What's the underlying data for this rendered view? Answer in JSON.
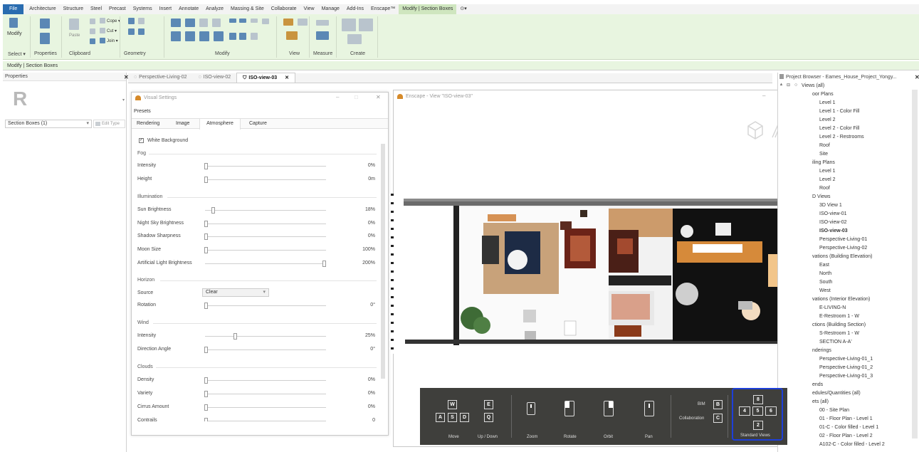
{
  "menu": {
    "items": [
      "File",
      "Architecture",
      "Structure",
      "Steel",
      "Precast",
      "Systems",
      "Insert",
      "Annotate",
      "Analyze",
      "Massing & Site",
      "Collaborate",
      "View",
      "Manage",
      "Add-Ins",
      "Enscape™",
      "Modify | Section Boxes"
    ],
    "active": "Modify | Section Boxes"
  },
  "ribbon": {
    "select_label": "Select ▾",
    "properties_label": "Properties",
    "clipboard_label": "Clipboard",
    "geometry_label": "Geometry",
    "modify_label": "Modify",
    "view_label": "View",
    "measure_label": "Measure",
    "create_label": "Create",
    "modify_button": "Modify",
    "paste_button": "Paste",
    "cope_button": "Cope ▾",
    "cut_button": "Cut ▾",
    "join_button": "Join ▾"
  },
  "context_bar": "Modify | Section Boxes",
  "properties": {
    "title": "Properties",
    "type_selector": "Section Boxes (1)",
    "edit_type": "Edit Type"
  },
  "tabs": [
    {
      "label": "Perspective-Living-02",
      "active": false
    },
    {
      "label": "ISO-view-02",
      "active": false
    },
    {
      "label": "ISO-view-03",
      "active": true
    }
  ],
  "visual_settings": {
    "title": "Visual Settings",
    "presets_label": "Presets",
    "tabs": [
      "Rendering",
      "Image",
      "Atmosphere",
      "Capture"
    ],
    "active_tab": "Atmosphere",
    "white_background": "White Background",
    "fog": {
      "label": "Fog",
      "intensity_label": "Intensity",
      "intensity_value": "0%",
      "height_label": "Height",
      "height_value": "0m"
    },
    "illumination": {
      "label": "Illumination",
      "rows": [
        {
          "label": "Sun Brightness",
          "value": "18%",
          "level": 0.06
        },
        {
          "label": "Night Sky Brightness",
          "value": "0%",
          "level": 0.0
        },
        {
          "label": "Shadow Sharpness",
          "value": "0%",
          "level": 0.0
        },
        {
          "label": "Moon Size",
          "value": "100%",
          "level": 0.0
        },
        {
          "label": "Artificial Light Brightness",
          "value": "200%",
          "level": 1.0
        }
      ]
    },
    "horizon": {
      "label": "Horizon",
      "source_label": "Source",
      "source_value": "Clear",
      "rotation_label": "Rotation",
      "rotation_value": "0°"
    },
    "wind": {
      "label": "Wind",
      "intensity_label": "Intensity",
      "intensity_value": "25%",
      "direction_label": "Direction Angle",
      "direction_value": "0°"
    },
    "clouds": {
      "label": "Clouds",
      "rows": [
        {
          "label": "Density",
          "value": "0%"
        },
        {
          "label": "Variety",
          "value": "0%"
        },
        {
          "label": "Cirrus Amount",
          "value": "0%"
        },
        {
          "label": "Contrails",
          "value": "0"
        }
      ]
    }
  },
  "enscape": {
    "title": "Enscape - View \"ISO-view-03\"",
    "controls": {
      "move_label": "Move",
      "updown_label": "Up / Down",
      "zoom_label": "Zoom",
      "rotate_label": "Rotate",
      "orbit_label": "Orbit",
      "pan_label": "Pan",
      "collab_label": "Collaboration",
      "bim_label": "BIM",
      "views_label": "Standard Views",
      "keys_move": [
        "W",
        "A",
        "S",
        "D"
      ],
      "keys_updown": [
        "E",
        "Q"
      ],
      "key_bim": "B",
      "key_collab": "C",
      "views_keys": [
        "8",
        "4",
        "5",
        "6",
        "2"
      ]
    }
  },
  "project_browser": {
    "title": "Project Browser - Eames_House_Project_Yongy...",
    "items": [
      "Views (all)",
      "oor Plans",
      "Level 1",
      "Level 1 - Color Fill",
      "Level 2",
      "Level 2 - Color Fill",
      "Level 2 - Restrooms",
      "Roof",
      "Site",
      "iling Plans",
      "Level 1",
      "Level 2",
      "Roof",
      "D Views",
      "3D View 1",
      "ISO-view-01",
      "ISO-view-02",
      "ISO-view-03",
      "Perspective-Living-01",
      "Perspective-Living-02",
      "vations (Building Elevation)",
      "East",
      "North",
      "South",
      "West",
      "vations (Interior Elevation)",
      "E-LIVING-N",
      "E-Restroom 1 - W",
      "ctions (Building Section)",
      "S-Restroom 1 - W",
      "SECTION A-A'",
      "nderings",
      "Perspective-Living-01_1",
      "Perspective-Living-01_2",
      "Perspective-Living-01_3",
      "ends",
      "edules/Quantities (all)",
      "ets (all)",
      "00 - Site Plan",
      "01 - Floor Plan - Level 1",
      "01-C - Color filled - Level 1",
      "02 - Floor Plan - Level 2",
      "A102-C - Color filled - Level 2"
    ],
    "selected": "ISO-view-03"
  }
}
